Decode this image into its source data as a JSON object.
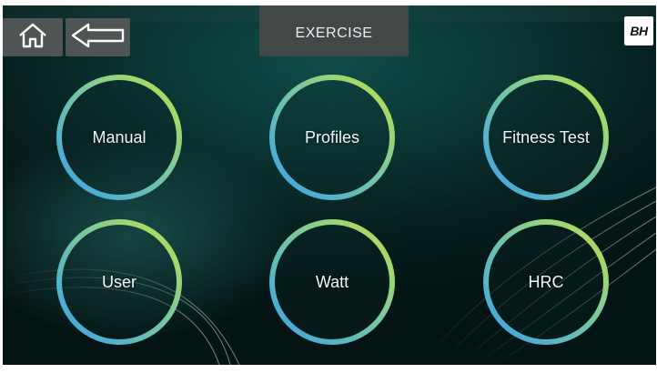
{
  "header": {
    "title": "EXERCISE",
    "home_icon": "home-icon",
    "back_icon": "back-arrow-icon",
    "logo_text": "BH"
  },
  "programs": [
    {
      "label": "Manual"
    },
    {
      "label": "Profiles"
    },
    {
      "label": "Fitness Test"
    },
    {
      "label": "User"
    },
    {
      "label": "Watt"
    },
    {
      "label": "HRC"
    }
  ],
  "colors": {
    "ring_green": "#b8e04a",
    "ring_blue": "#3ea6e6",
    "background": "#0a3836",
    "nav_button": "#4f5555"
  }
}
